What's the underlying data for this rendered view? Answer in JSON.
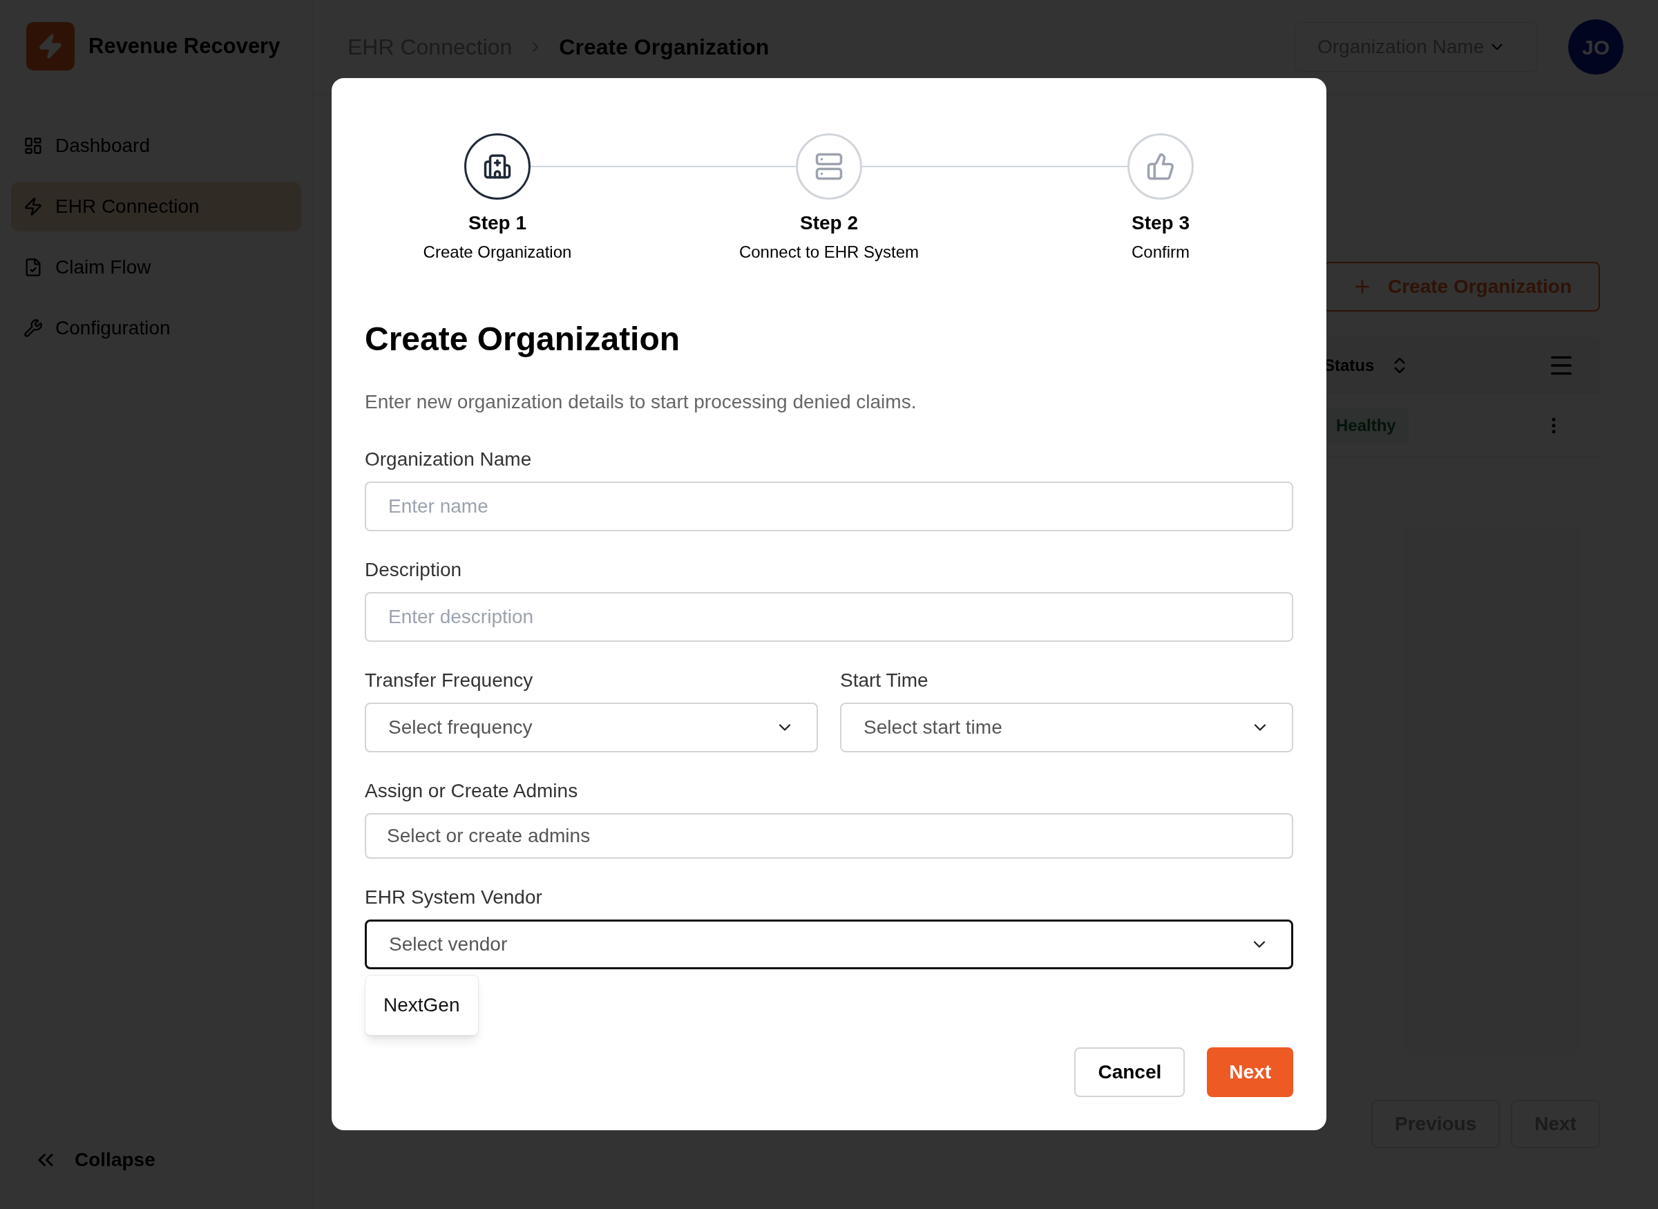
{
  "sidebar": {
    "brand": "Revenue Recovery",
    "items": [
      {
        "label": "Dashboard",
        "selected": false
      },
      {
        "label": "EHR Connection",
        "selected": true
      },
      {
        "label": "Claim Flow",
        "selected": false
      },
      {
        "label": "Configuration",
        "selected": false
      }
    ],
    "collapse": "Collapse"
  },
  "header": {
    "breadcrumb": [
      {
        "label": "EHR Connection",
        "current": false
      },
      {
        "label": "Create Organization",
        "current": true
      }
    ],
    "org_select": {
      "placeholder": "Organization Name"
    },
    "avatar": "JO"
  },
  "page": {
    "create_button": "Create Organization",
    "table": {
      "columns": [
        {
          "label": "Status"
        }
      ],
      "rows": [
        {
          "status": "Healthy"
        }
      ]
    },
    "pagination": [
      "Previous",
      "Next"
    ]
  },
  "dialog": {
    "steps": [
      {
        "title": "Step 1",
        "subtitle": "Create Organization",
        "current": true
      },
      {
        "title": "Step 2",
        "subtitle": "Connect to EHR System",
        "current": false
      },
      {
        "title": "Step 3",
        "subtitle": "Confirm",
        "current": false
      }
    ],
    "title": "Create Organization",
    "description": "Enter new organization details to start processing denied claims.",
    "rows": [
      {
        "fields": [
          {
            "label": "Organization Name",
            "kind": "text",
            "placeholder": "Enter name"
          }
        ]
      },
      {
        "fields": [
          {
            "label": "Description",
            "kind": "text",
            "placeholder": "Enter description"
          }
        ]
      },
      {
        "fields": [
          {
            "label": "Transfer Frequency",
            "kind": "select",
            "placeholder": "Select frequency",
            "focused": false
          },
          {
            "label": "Start Time",
            "kind": "select",
            "placeholder": "Select start time",
            "focused": false
          }
        ]
      },
      {
        "fields": [
          {
            "label": "Assign or Create Admins",
            "kind": "multi",
            "placeholder": "Select or create admins"
          }
        ]
      },
      {
        "fields": [
          {
            "label": "EHR System Vendor",
            "kind": "select",
            "placeholder": "Select vendor",
            "focused": true,
            "options": [
              "NextGen"
            ]
          }
        ]
      }
    ],
    "buttons": [
      {
        "label": "Cancel",
        "kind": "secondary"
      },
      {
        "label": "Next",
        "kind": "primary"
      }
    ]
  }
}
